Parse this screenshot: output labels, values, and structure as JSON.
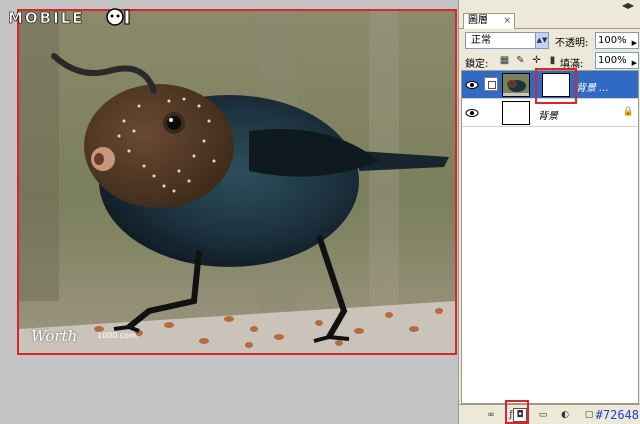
{
  "watermark": {
    "text": "MOBILE"
  },
  "photo": {
    "credit": "Worth",
    "credit_site": "1000.com"
  },
  "panel": {
    "menu_icon": "panel-menu-icon",
    "tab_label": "圖層",
    "tab_close": "×",
    "blend_mode": {
      "value": "正常"
    },
    "opacity": {
      "label": "不透明:",
      "value": "100%"
    },
    "lock": {
      "label": "鎖定:"
    },
    "fill": {
      "label": "填滿:",
      "value": "100%"
    },
    "layers": [
      {
        "name": "背景 ...",
        "selected": true,
        "has_mask": true
      },
      {
        "name": "背景",
        "selected": false,
        "locked": true,
        "lock_glyph": "🔒"
      }
    ]
  },
  "footer": {
    "post_number": "#72648"
  },
  "colors": {
    "highlight": "#d8262b",
    "selection": "#316ac5",
    "post_number": "#1d3fd6"
  }
}
